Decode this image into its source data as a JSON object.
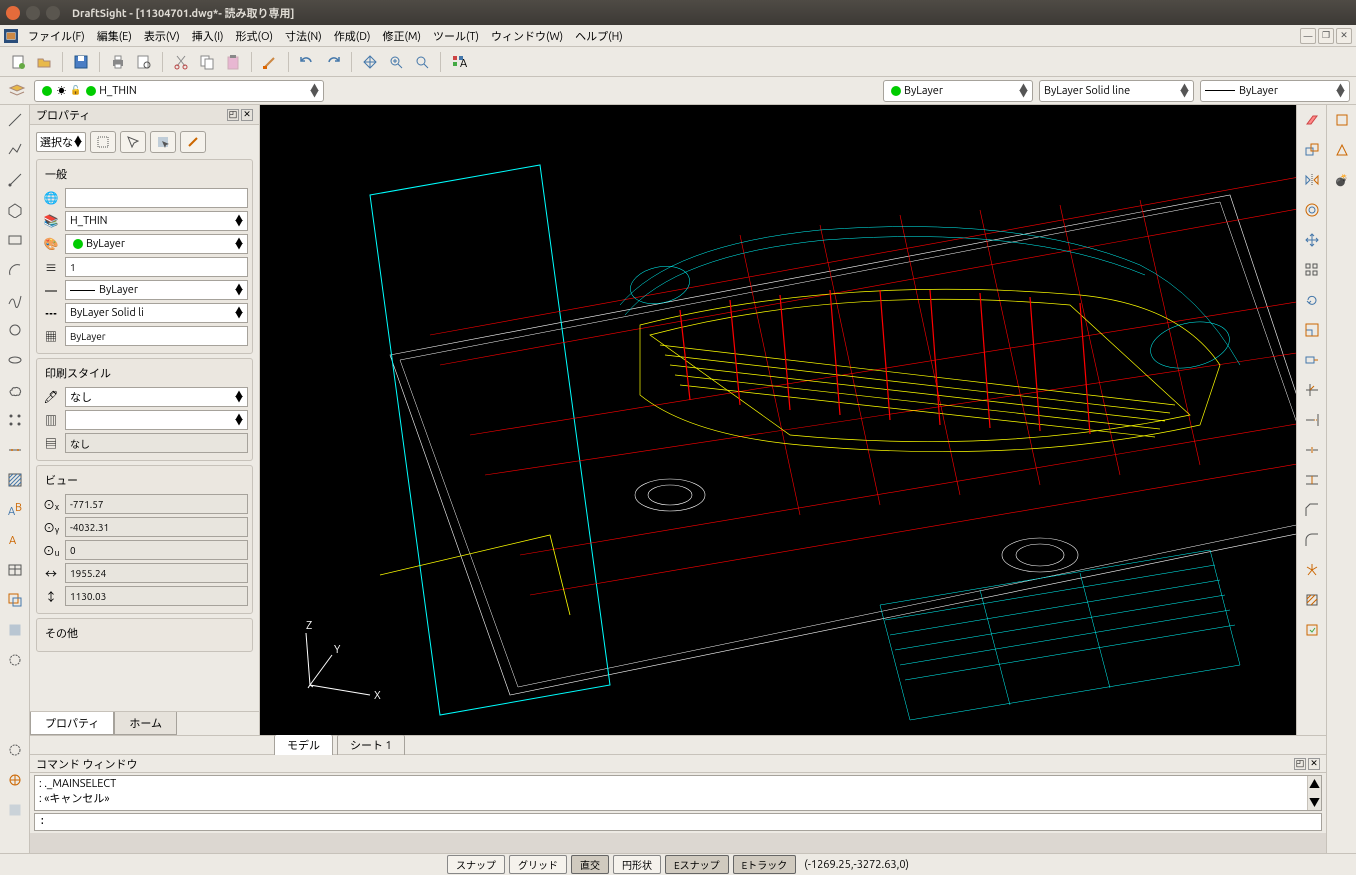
{
  "window": {
    "title": "DraftSight - [11304701.dwg*- 読み取り専用]"
  },
  "menubar": [
    "ファイル(F)",
    "編集(E)",
    "表示(V)",
    "挿入(I)",
    "形式(O)",
    "寸法(N)",
    "作成(D)",
    "修正(M)",
    "ツール(T)",
    "ウィンドウ(W)",
    "ヘルプ(H)"
  ],
  "layerbar": {
    "layer_name": "H_THIN",
    "color": "ByLayer",
    "linestyle": "ByLayer   Solid line",
    "lineweight": "ByLayer"
  },
  "properties": {
    "panel_title": "プロパティ",
    "selectmode": "選択な",
    "group_general": "一般",
    "hyperlink": "",
    "layer": "H_THIN",
    "color": "ByLayer",
    "scale": "1",
    "lineweight": "ByLayer",
    "linestyle": "ByLayer   Solid li",
    "transparency": "ByLayer",
    "group_print": "印刷スタイル",
    "print_style": "なし",
    "print_color": "",
    "print_table": "なし",
    "group_view": "ビュー",
    "view_x": "-771.57",
    "view_y": "-4032.31",
    "view_z": "0",
    "view_w": "1955.24",
    "view_h": "1130.03",
    "group_other": "その他",
    "tabs": [
      "プロパティ",
      "ホーム"
    ]
  },
  "canvastabs": [
    "モデル",
    "シート 1"
  ],
  "command": {
    "title": "コマンド ウィンドウ",
    "history": [
      ": ._MAINSELECT",
      ": «キャンセル»"
    ],
    "prompt": ":"
  },
  "statusbar": {
    "buttons": [
      {
        "label": "スナップ",
        "on": false
      },
      {
        "label": "グリッド",
        "on": false
      },
      {
        "label": "直交",
        "on": true
      },
      {
        "label": "円形状",
        "on": false
      },
      {
        "label": "Eスナップ",
        "on": true
      },
      {
        "label": "Eトラック",
        "on": true
      }
    ],
    "coords": "(-1269.25,-3272.63,0)"
  }
}
